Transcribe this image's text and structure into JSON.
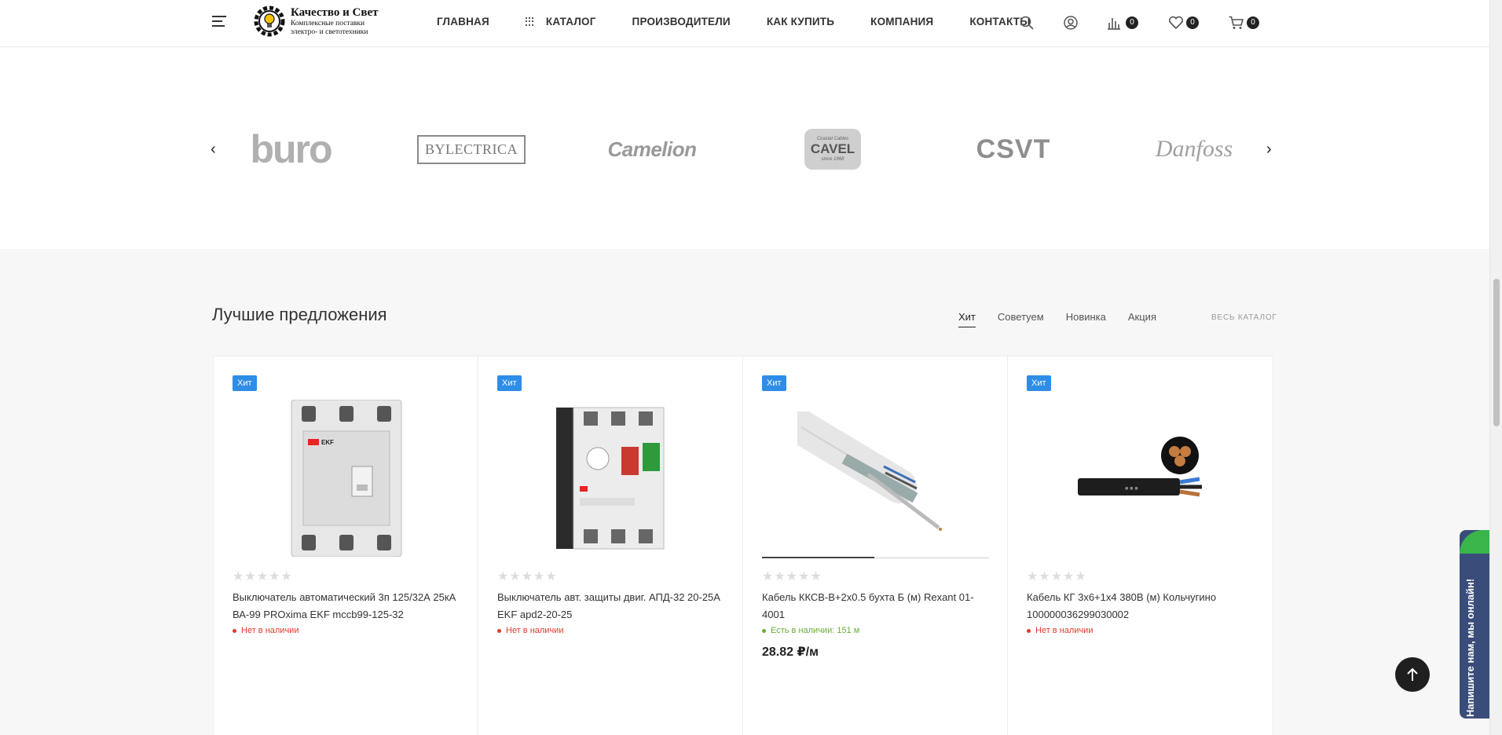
{
  "header": {
    "logo_title": "Качество и Свет",
    "logo_subtitle": "Комплексные поставки электро- и светотехники",
    "nav": [
      "ГЛАВНАЯ",
      "КАТАЛОГ",
      "ПРОИЗВОДИТЕЛИ",
      "КАК КУПИТЬ",
      "КОМПАНИЯ",
      "КОНТАКТЫ"
    ],
    "compare_count": "0",
    "favorites_count": "0",
    "cart_count": "0"
  },
  "brands": {
    "items": [
      "buro",
      "BYLECTRICA",
      "Camelion",
      "CAVEL",
      "CSVT",
      "Danfoss"
    ],
    "cavel_top": "Coaxial Cables",
    "cavel_bottom": "since 1968"
  },
  "offers": {
    "title": "Лучшие предложения",
    "tabs": [
      "Хит",
      "Советуем",
      "Новинка",
      "Акция"
    ],
    "active_tab": "Хит",
    "all_catalog": "ВЕСЬ КАТАЛОГ",
    "products": [
      {
        "badge": "Хит",
        "name": "Выключатель автоматический 3п 125/32А 25кА ВА-99 PROxima EKF mccb99-125-32",
        "stock": "Нет в наличии",
        "price": ""
      },
      {
        "badge": "Хит",
        "name": "Выключатель авт. защиты двиг. АПД-32 20-25А EKF apd2-20-25",
        "stock": "Нет в наличии",
        "price": ""
      },
      {
        "badge": "Хит",
        "name": "Кабель ККСВ-В+2х0.5 бухта Б (м) Rexant 01-4001",
        "stock": "Есть в наличии: 151 м",
        "price": "28.82 ₽/м"
      },
      {
        "badge": "Хит",
        "name": "Кабель КГ 3х6+1х4 380В (м) Кольчугино 100000036299030002",
        "stock": "Нет в наличии",
        "price": ""
      }
    ]
  },
  "chat": {
    "label": "Напишите нам, мы онлайн!"
  },
  "colors": {
    "badge": "#2e8de6",
    "out_of_stock": "#e23a2e",
    "in_stock": "#6aac3b",
    "chat": "#3a4d7a"
  }
}
